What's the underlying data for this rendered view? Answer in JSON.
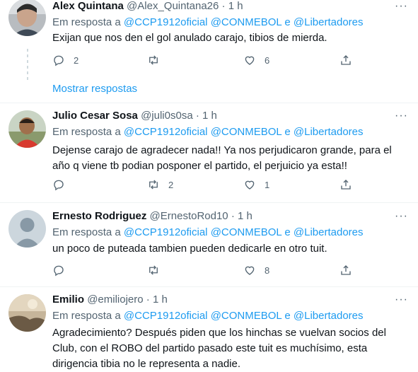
{
  "tweets": [
    {
      "name": "Alex Quintana",
      "handle": "@Alex_Quintana26",
      "dot": "·",
      "time": "1 h",
      "reply_prefix": "Em resposta a",
      "mention1": "@CCP1912oficial",
      "mention2": "@CONMEBOL",
      "conj": "e",
      "mention3": "@Libertadores",
      "text": "Exijan que nos den el gol anulado carajo, tibios de mierda.",
      "replies": "2",
      "retweets": "",
      "likes": "6"
    },
    {
      "name": "Julio Cesar Sosa",
      "handle": "@juli0s0sa",
      "dot": "·",
      "time": "1 h",
      "reply_prefix": "Em resposta a",
      "mention1": "@CCP1912oficial",
      "mention2": "@CONMEBOL",
      "conj": "e",
      "mention3": "@Libertadores",
      "text": "Dejense carajo de agradecer nada!! Ya nos perjudicaron grande, para el año q viene tb podian posponer el partido, el perjuicio ya esta!!",
      "replies": "",
      "retweets": "2",
      "likes": "1"
    },
    {
      "name": "Ernesto Rodriguez",
      "handle": "@ErnestoRod10",
      "dot": "·",
      "time": "1 h",
      "reply_prefix": "Em resposta a",
      "mention1": "@CCP1912oficial",
      "mention2": "@CONMEBOL",
      "conj": "e",
      "mention3": "@Libertadores",
      "text": "un poco de puteada tambien pueden dedicarle en otro tuit.",
      "replies": "",
      "retweets": "",
      "likes": "8"
    },
    {
      "name": "Emilio",
      "handle": "@emiliojero",
      "dot": "·",
      "time": "1 h",
      "reply_prefix": "Em resposta a",
      "mention1": "@CCP1912oficial",
      "mention2": "@CONMEBOL",
      "conj": "e",
      "mention3": "@Libertadores",
      "text": "Agradecimiento? Después piden que los hinchas se vuelvan socios del Club, con el ROBO del partido pasado este tuit es muchísimo, esta dirigencia tibia no le representa a nadie."
    }
  ],
  "show_more": "Mostrar respostas",
  "more_glyph": "···",
  "colors": {
    "accent": "#1d9bf0",
    "muted": "#536471",
    "text": "#0f1419",
    "border": "#eff3f4"
  }
}
